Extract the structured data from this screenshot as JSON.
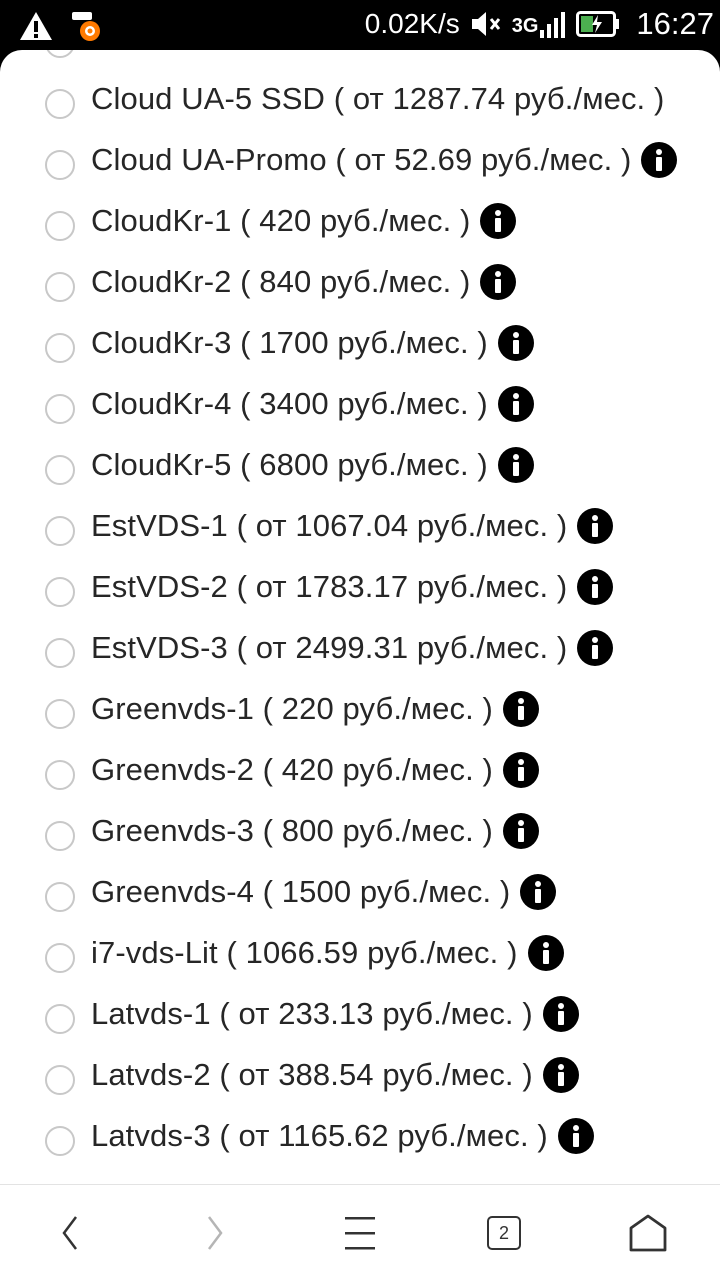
{
  "status_bar": {
    "net_speed": "0.02K/s",
    "network": "3G",
    "time": "16:27",
    "icons": [
      "warning-icon",
      "notification-app-icon",
      "mute-icon",
      "signal-icon",
      "battery-charging-icon"
    ]
  },
  "plans": [
    {
      "label": "Cloud UA-5 SSD ( от 1287.74 руб./мес. )",
      "info": false
    },
    {
      "label": "Cloud UA-Promo ( от 52.69 руб./мес. )",
      "info": true
    },
    {
      "label": "CloudKr-1 ( 420 руб./мес. )",
      "info": true
    },
    {
      "label": "CloudKr-2 ( 840 руб./мес. )",
      "info": true
    },
    {
      "label": "CloudKr-3 ( 1700 руб./мес. )",
      "info": true
    },
    {
      "label": "CloudKr-4 ( 3400 руб./мес. )",
      "info": true
    },
    {
      "label": "CloudKr-5 ( 6800 руб./мес. )",
      "info": true
    },
    {
      "label": "EstVDS-1 ( от 1067.04 руб./мес. )",
      "info": true
    },
    {
      "label": "EstVDS-2 ( от 1783.17 руб./мес. )",
      "info": true
    },
    {
      "label": "EstVDS-3 ( от 2499.31 руб./мес. )",
      "info": true
    },
    {
      "label": "Greenvds-1 ( 220 руб./мес. )",
      "info": true
    },
    {
      "label": "Greenvds-2 ( 420 руб./мес. )",
      "info": true
    },
    {
      "label": "Greenvds-3 ( 800 руб./мес. )",
      "info": true
    },
    {
      "label": "Greenvds-4 ( 1500 руб./мес. )",
      "info": true
    },
    {
      "label": "i7-vds-Lit ( 1066.59 руб./мес. )",
      "info": true
    },
    {
      "label": "Latvds-1 ( от 233.13 руб./мес. )",
      "info": true
    },
    {
      "label": "Latvds-2 ( от 388.54 руб./мес. )",
      "info": true
    },
    {
      "label": "Latvds-3 ( от 1165.62 руб./мес. )",
      "info": true
    }
  ],
  "bottom_nav": {
    "back_icon": "chevron-left-icon",
    "forward_icon": "chevron-right-icon",
    "menu_icon": "hamburger-menu-icon",
    "tabs_count": "2",
    "home_icon": "home-icon"
  }
}
